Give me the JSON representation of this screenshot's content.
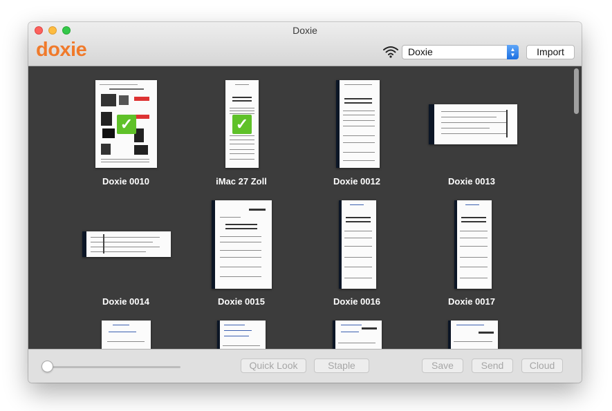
{
  "window": {
    "title": "Doxie"
  },
  "header": {
    "logo_text": "doxie",
    "device_selected": "Doxie",
    "import_label": "Import",
    "wifi_icon": "wifi-icon"
  },
  "scans": [
    {
      "label": "Doxie 0010",
      "selected": true
    },
    {
      "label": "iMac 27 Zoll",
      "selected": true
    },
    {
      "label": "Doxie 0012",
      "selected": false
    },
    {
      "label": "Doxie 0013",
      "selected": false
    },
    {
      "label": "Doxie 0014",
      "selected": false
    },
    {
      "label": "Doxie 0015",
      "selected": false
    },
    {
      "label": "Doxie 0016",
      "selected": false
    },
    {
      "label": "Doxie 0017",
      "selected": false
    },
    {
      "label": "",
      "selected": false
    },
    {
      "label": "",
      "selected": false
    },
    {
      "label": "",
      "selected": false
    },
    {
      "label": "",
      "selected": false
    }
  ],
  "toolbar": {
    "quick_look_label": "Quick Look",
    "staple_label": "Staple",
    "save_label": "Save",
    "send_label": "Send",
    "cloud_label": "Cloud"
  },
  "colors": {
    "brand": "#f07a2b",
    "content_background": "#3c3c3c",
    "selected_check": "#5fc129"
  }
}
